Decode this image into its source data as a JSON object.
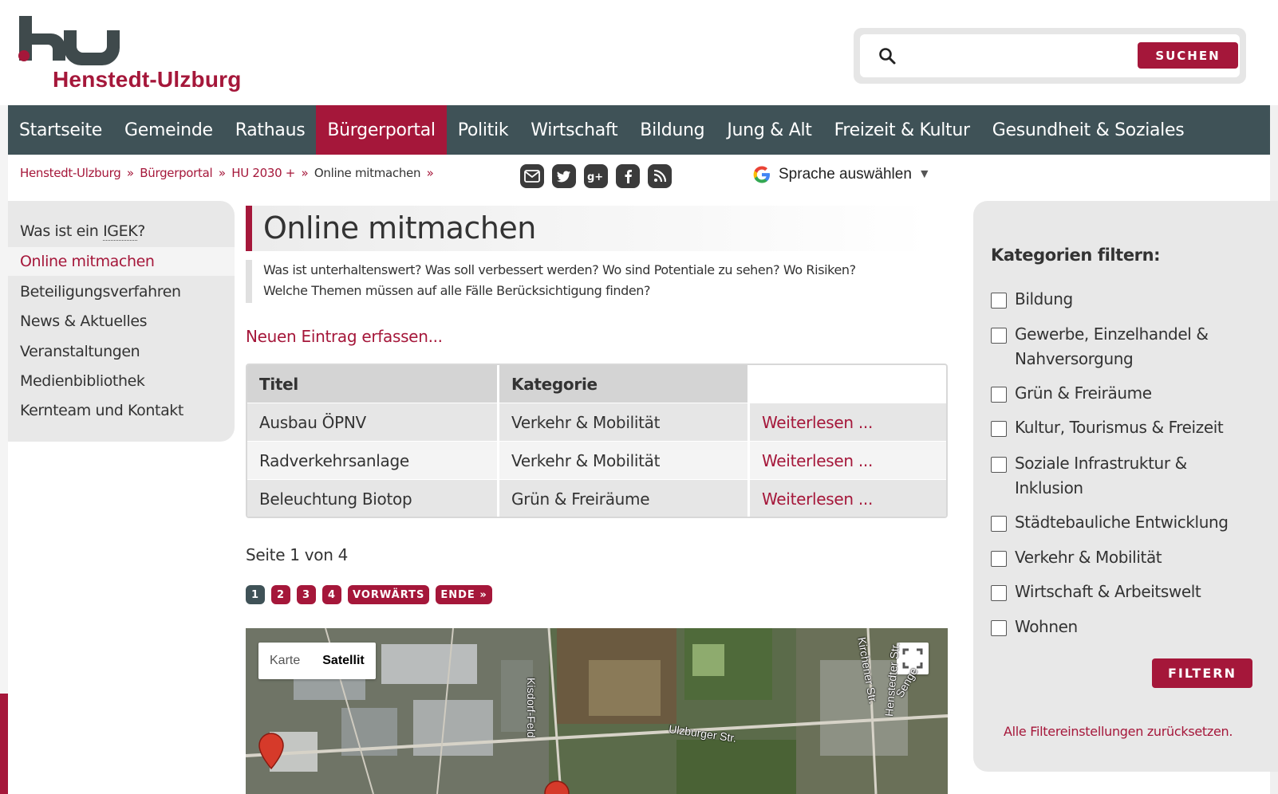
{
  "site": {
    "name": "Henstedt-Ulzburg",
    "brand_color": "#a5173a",
    "nav_color": "#3f5257"
  },
  "search": {
    "placeholder": "",
    "button_label": "SUCHEN",
    "icon": "search-icon"
  },
  "nav": {
    "items": [
      {
        "label": "Startseite",
        "active": false
      },
      {
        "label": "Gemeinde",
        "active": false
      },
      {
        "label": "Rathaus",
        "active": false
      },
      {
        "label": "Bürgerportal",
        "active": true
      },
      {
        "label": "Politik",
        "active": false
      },
      {
        "label": "Wirtschaft",
        "active": false
      },
      {
        "label": "Bildung",
        "active": false
      },
      {
        "label": "Jung & Alt",
        "active": false
      },
      {
        "label": "Freizeit & Kultur",
        "active": false
      },
      {
        "label": "Gesundheit & Soziales",
        "active": false
      }
    ]
  },
  "breadcrumb": {
    "items": [
      "Henstedt-Ulzburg",
      "Bürgerportal",
      "HU 2030 +"
    ],
    "separator": "»",
    "current": "Online mitmachen"
  },
  "social": {
    "icons": [
      "mail-icon",
      "twitter-icon",
      "google-plus-icon",
      "facebook-icon",
      "rss-icon"
    ]
  },
  "language": {
    "label": "Sprache auswählen",
    "arrow": "▼"
  },
  "sidebar_left": {
    "items": [
      {
        "label_prefix": "Was ist ein ",
        "abbr": "IGEK",
        "label_suffix": "?",
        "active": false
      },
      {
        "label": "Online mitmachen",
        "active": true
      },
      {
        "label": "Beteiligungsverfahren",
        "active": false
      },
      {
        "label": "News & Aktuelles",
        "active": false
      },
      {
        "label": "Veranstaltungen",
        "active": false
      },
      {
        "label": "Medienbibliothek",
        "active": false
      },
      {
        "label": "Kernteam und Kontakt",
        "active": false
      }
    ]
  },
  "main": {
    "title": "Online mitmachen",
    "intro_line1": "Was ist unterhaltenswert? Was soll verbessert werden? Wo sind Potentiale zu sehen? Wo Risiken?",
    "intro_line2": "Welche Themen müssen auf alle Fälle Berücksichtigung finden?",
    "new_entry_link": "Neuen Eintrag erfassen...",
    "table": {
      "headers": [
        "Titel",
        "Kategorie",
        ""
      ],
      "rows": [
        {
          "titel": "Ausbau ÖPNV",
          "kategorie": "Verkehr & Mobilität",
          "link": "Weiterlesen ..."
        },
        {
          "titel": "Radverkehrsanlage",
          "kategorie": "Verkehr & Mobilität",
          "link": "Weiterlesen ..."
        },
        {
          "titel": "Beleuchtung Biotop",
          "kategorie": "Grün & Freiräume",
          "link": "Weiterlesen ..."
        }
      ]
    },
    "page_info": "Seite 1 von 4",
    "pager": {
      "pages": [
        "1",
        "2",
        "3",
        "4"
      ],
      "current": "1",
      "next": "VORWÄRTS",
      "end": "ENDE »"
    }
  },
  "map": {
    "type_map": "Karte",
    "type_satellite": "Satellit",
    "selected": "Satellit",
    "streets": [
      "Kisdorf-Feld",
      "Ulzburger Str.",
      "Kirchener Str.",
      "Senge",
      "Henstedter Str."
    ]
  },
  "sidebar_right": {
    "title": "Kategorien filtern:",
    "categories": [
      {
        "line1": "Bildung",
        "line2": ""
      },
      {
        "line1": "Gewerbe, Einzelhandel &",
        "line2": "Nahversorgung"
      },
      {
        "line1": "Grün & Freiräume",
        "line2": ""
      },
      {
        "line1": "Kultur, Tourismus & Freizeit",
        "line2": ""
      },
      {
        "line1": "Soziale Infrastruktur &",
        "line2": "Inklusion"
      },
      {
        "line1": "Städtebauliche Entwicklung",
        "line2": ""
      },
      {
        "line1": "Verkehr & Mobilität",
        "line2": ""
      },
      {
        "line1": "Wirtschaft & Arbeitswelt",
        "line2": ""
      },
      {
        "line1": "Wohnen",
        "line2": ""
      }
    ],
    "filter_button": "FILTERN",
    "reset_link": "Alle Filtereinstellungen zurücksetzen."
  }
}
